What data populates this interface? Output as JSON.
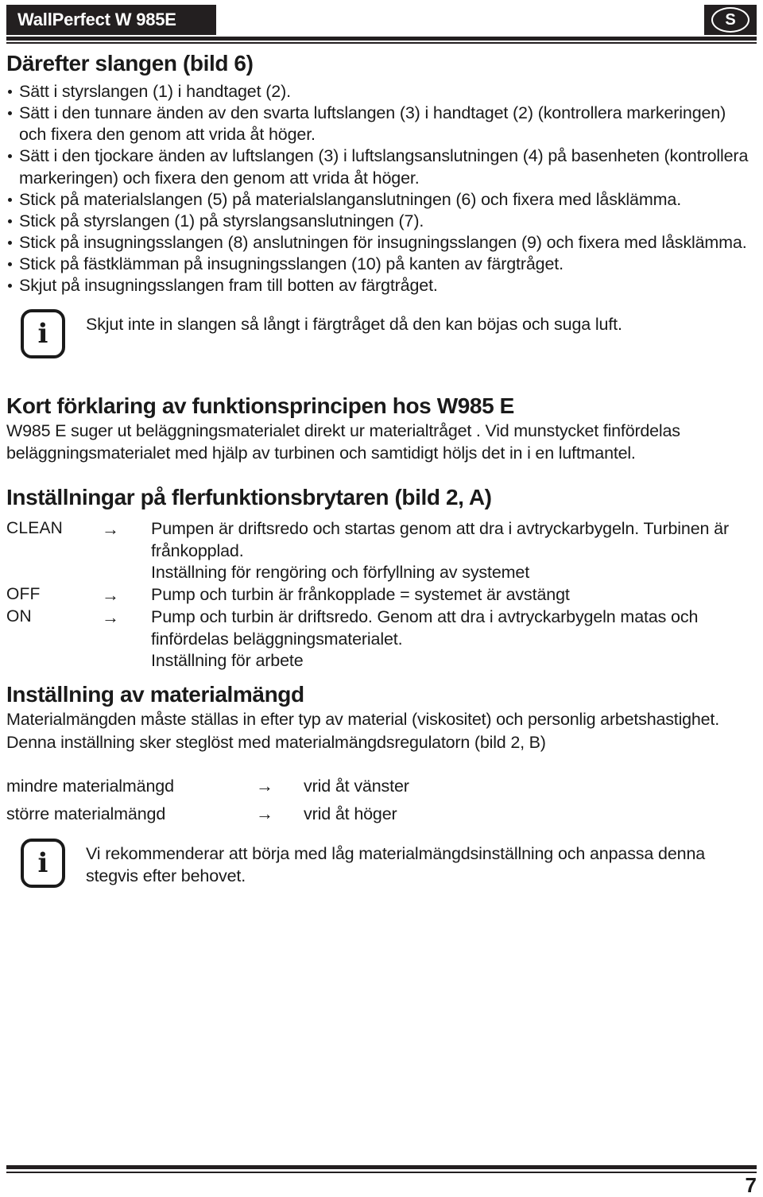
{
  "header": {
    "product_title": "WallPerfect W 985E",
    "language_badge": "S"
  },
  "sections": {
    "hose": {
      "heading": "Därefter slangen (bild 6)",
      "bullets": [
        "Sätt i styrslangen (1) i handtaget (2).",
        "Sätt i den tunnare änden av den svarta luftslangen (3) i handtaget (2) (kontrollera markeringen) och fixera den genom att vrida åt höger.",
        "Sätt i den tjockare änden av luftslangen (3) i luftslangsanslutningen (4) på basenheten (kontrollera markeringen) och fixera den genom att vrida åt höger.",
        "Stick på materialslangen (5) på materialslanganslutningen (6) och fixera med låsklämma.",
        "Stick på styrslangen (1) på styrslangsanslutningen (7).",
        "Stick på insugningsslangen (8) anslutningen för insugningsslangen (9) och fixera med låsklämma.",
        "Stick på fästklämman på insugningsslangen (10) på kanten av färgtråget.",
        "Skjut på insugningsslangen fram till botten av färgtråget."
      ],
      "note": {
        "icon": "info-icon",
        "glyph": "i",
        "text": "Skjut inte in slangen så långt i färgtråget då den kan böjas och suga luft."
      }
    },
    "principle": {
      "heading": "Kort förklaring av funktionsprincipen hos W985 E",
      "paragraph": "W985 E suger ut beläggningsmaterialet direkt ur materialtråget . Vid munstycket finfördelas beläggningsmaterialet med hjälp av turbinen och samtidigt höljs det in i en luftmantel."
    },
    "switch_settings": {
      "heading": "Inställningar på flerfunktionsbrytaren (bild 2, A)",
      "arrow": "→",
      "rows": [
        {
          "label": "CLEAN",
          "desc": "Pumpen är driftsredo och startas genom att dra i avtryckarbygeln. Turbinen är frånkopplad.",
          "extra": "Inställning för rengöring och förfyllning av systemet"
        },
        {
          "label": "OFF",
          "desc": "Pump och turbin är frånkopplade = systemet är avstängt",
          "extra": ""
        },
        {
          "label": "ON",
          "desc": "Pump och turbin är driftsredo. Genom att dra i avtryckarbygeln matas och finfördelas beläggningsmaterialet.",
          "extra": "Inställning för arbete"
        }
      ]
    },
    "material_amount": {
      "heading": "Inställning av materialmängd",
      "paragraph_1": "Materialmängden måste ställas in efter typ av material (viskositet) och personlig arbetshastighet.",
      "paragraph_2": "Denna inställning sker steglöst med materialmängdsregulatorn (bild 2, B)",
      "arrow": "→",
      "rows": [
        {
          "label": "mindre materialmängd",
          "value": "vrid åt vänster"
        },
        {
          "label": "större materialmängd",
          "value": "vrid åt höger"
        }
      ],
      "note": {
        "icon": "info-icon",
        "glyph": "i",
        "text": "Vi rekommenderar att börja med låg materialmängdsinställning och anpassa denna stegvis efter behovet."
      }
    }
  },
  "footer": {
    "page_number": "7"
  }
}
